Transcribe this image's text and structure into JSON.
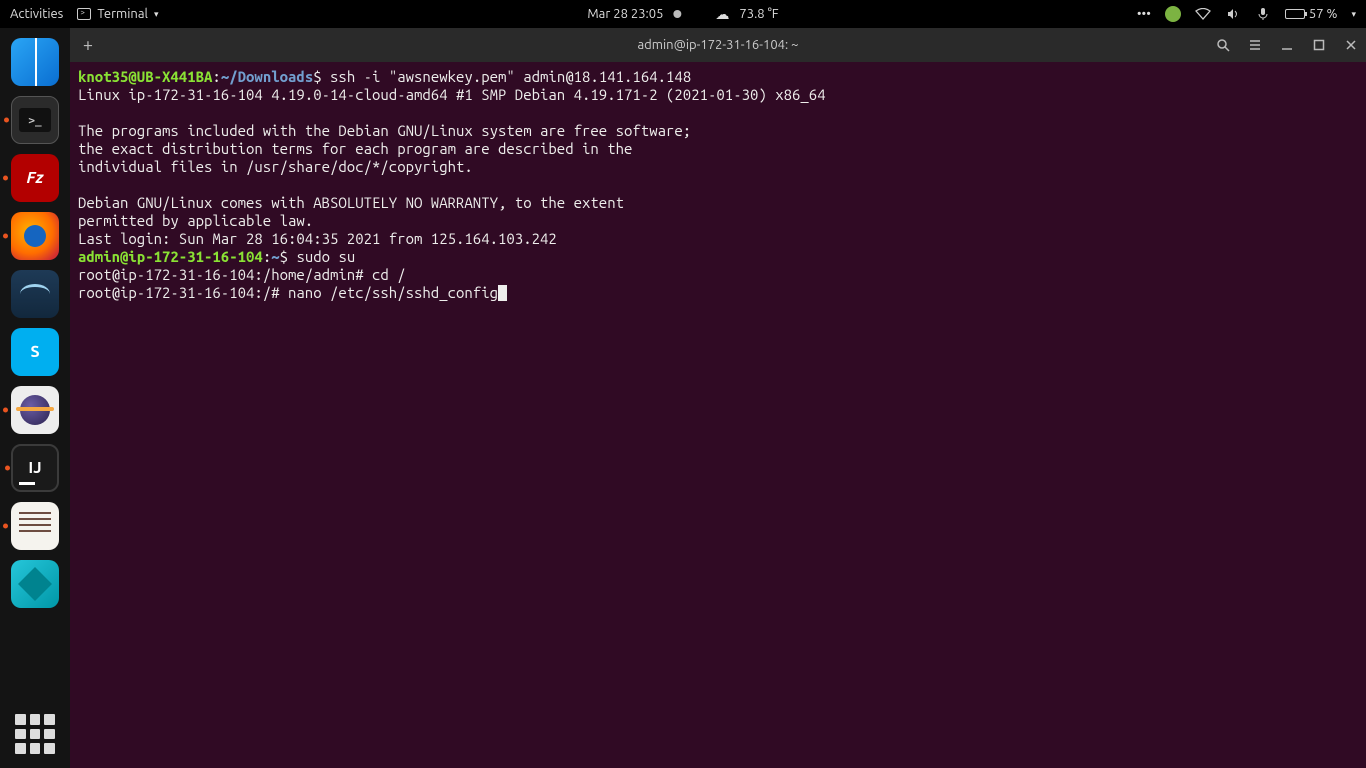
{
  "topbar": {
    "activities": "Activities",
    "app_menu_label": "Terminal",
    "datetime": "Mar 28  23:05",
    "weather_temp": "73.8 °F",
    "battery_pct": "57 %"
  },
  "window": {
    "title": "admin@ip-172-31-16-104: ~",
    "newtab_tooltip": "+"
  },
  "dock": {
    "items": [
      {
        "name": "finder"
      },
      {
        "name": "terminal",
        "running": true
      },
      {
        "name": "filezilla",
        "running": true,
        "glyph": "Fz"
      },
      {
        "name": "firefox",
        "running": true
      },
      {
        "name": "mysql-workbench"
      },
      {
        "name": "skype",
        "glyph": "S"
      },
      {
        "name": "eclipse",
        "running": true
      },
      {
        "name": "intellij",
        "running": true,
        "glyph": "IJ"
      },
      {
        "name": "gedit",
        "running": true
      },
      {
        "name": "manager"
      }
    ]
  },
  "terminal": {
    "line1_user": "knot35@UB-X441BA",
    "line1_sep": ":",
    "line1_path": "~/Downloads",
    "line1_prompt": "$ ",
    "line1_cmd": "ssh -i \"awsnewkey.pem\" admin@18.141.164.148",
    "line2": "Linux ip-172-31-16-104 4.19.0-14-cloud-amd64 #1 SMP Debian 4.19.171-2 (2021-01-30) x86_64",
    "blank1": "",
    "line3": "The programs included with the Debian GNU/Linux system are free software;",
    "line4": "the exact distribution terms for each program are described in the",
    "line5": "individual files in /usr/share/doc/*/copyright.",
    "blank2": "",
    "line6": "Debian GNU/Linux comes with ABSOLUTELY NO WARRANTY, to the extent",
    "line7": "permitted by applicable law.",
    "line8": "Last login: Sun Mar 28 16:04:35 2021 from 125.164.103.242",
    "line9_user": "admin@ip-172-31-16-104",
    "line9_sep": ":",
    "line9_path": "~",
    "line9_prompt": "$ ",
    "line9_cmd": "sudo su",
    "line10": "root@ip-172-31-16-104:/home/admin# cd /",
    "line11": "root@ip-172-31-16-104:/# nano /etc/ssh/sshd_config"
  }
}
